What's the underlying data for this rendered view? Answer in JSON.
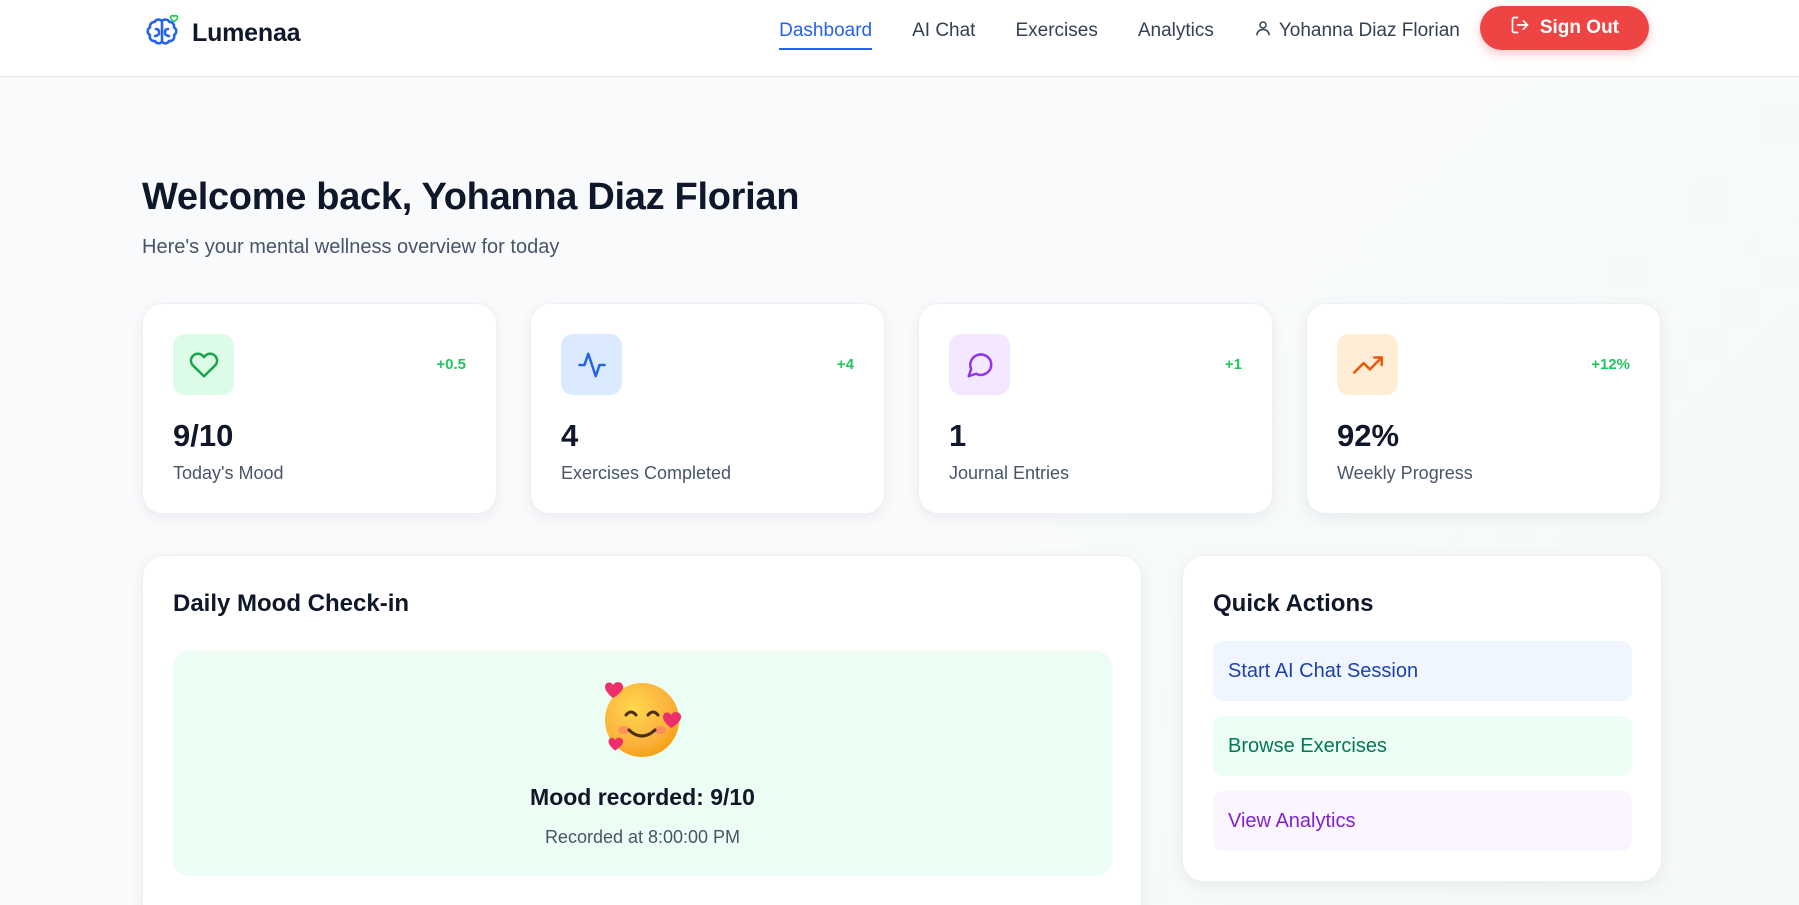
{
  "header": {
    "brand_name": "Lumenaa",
    "brand_icon": "brain-heart-icon",
    "nav": [
      {
        "label": "Dashboard",
        "active": true
      },
      {
        "label": "AI Chat",
        "active": false
      },
      {
        "label": "Exercises",
        "active": false
      },
      {
        "label": "Analytics",
        "active": false
      }
    ],
    "user_name": "Yohanna Diaz Florian",
    "user_icon": "user-icon",
    "signout_label": "Sign Out",
    "signout_icon": "log-out-icon"
  },
  "welcome": {
    "title": "Welcome back, Yohanna Diaz Florian",
    "subtitle": "Here's your mental wellness overview for today"
  },
  "stats": [
    {
      "icon": "heart-icon",
      "value": "9/10",
      "label": "Today's Mood",
      "delta": "+0.5",
      "icon_bg": "#dcfce7",
      "icon_color": "#16a34a"
    },
    {
      "icon": "activity-icon",
      "value": "4",
      "label": "Exercises Completed",
      "delta": "+4",
      "icon_bg": "#dbeafe",
      "icon_color": "#2563eb"
    },
    {
      "icon": "message-circle-icon",
      "value": "1",
      "label": "Journal Entries",
      "delta": "+1",
      "icon_bg": "#f3e8ff",
      "icon_color": "#9333ea"
    },
    {
      "icon": "trending-up-icon",
      "value": "92%",
      "label": "Weekly Progress",
      "delta": "+12%",
      "icon_bg": "#ffedd5",
      "icon_color": "#ea580c"
    }
  ],
  "mood_checkin": {
    "title": "Daily Mood Check-in",
    "emoji": "smiling-face-with-hearts",
    "recorded_text": "Mood recorded: 9/10",
    "recorded_time": "Recorded at 8:00:00 PM"
  },
  "quick_actions": {
    "title": "Quick Actions",
    "items": [
      {
        "label": "Start AI Chat Session"
      },
      {
        "label": "Browse Exercises"
      },
      {
        "label": "View Analytics"
      }
    ]
  },
  "colors": {
    "accent": "#2563eb",
    "danger": "#ef4444",
    "positive": "#22c55e"
  }
}
